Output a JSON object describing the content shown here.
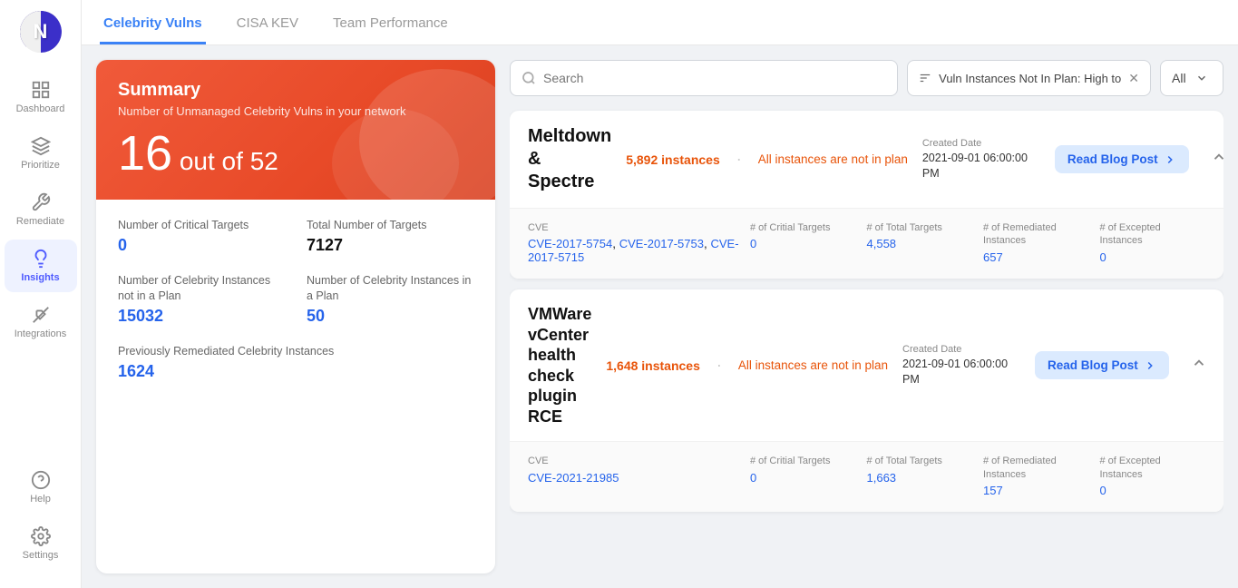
{
  "app": {
    "logo_letter": "N"
  },
  "sidebar": {
    "items": [
      {
        "id": "dashboard",
        "label": "Dashboard",
        "icon": "grid"
      },
      {
        "id": "prioritize",
        "label": "Prioritize",
        "icon": "layers"
      },
      {
        "id": "remediate",
        "label": "Remediate",
        "icon": "wrench"
      },
      {
        "id": "insights",
        "label": "Insights",
        "icon": "lightbulb",
        "active": true
      },
      {
        "id": "integrations",
        "label": "Integrations",
        "icon": "plug"
      }
    ],
    "bottom_items": [
      {
        "id": "help",
        "label": "Help",
        "icon": "question"
      },
      {
        "id": "settings",
        "label": "Settings",
        "icon": "gear"
      }
    ]
  },
  "tabs": [
    {
      "id": "celebrity-vulns",
      "label": "Celebrity Vulns",
      "active": true
    },
    {
      "id": "cisa-kev",
      "label": "CISA KEV",
      "active": false
    },
    {
      "id": "team-performance",
      "label": "Team Performance",
      "active": false
    }
  ],
  "summary": {
    "title": "Summary",
    "subtitle": "Number of Unmanaged Celebrity Vulns in your network",
    "count": "16",
    "out_of": "out of 52",
    "stats": [
      {
        "id": "critical-targets",
        "label": "Number of Critical Targets",
        "value": "0",
        "link": true
      },
      {
        "id": "total-targets",
        "label": "Total Number of Targets",
        "value": "7127",
        "link": false
      },
      {
        "id": "instances-not-in-plan",
        "label": "Number of Celebrity Instances not in a Plan",
        "value": "15032",
        "link": true
      },
      {
        "id": "instances-in-plan",
        "label": "Number of Celebrity Instances in a Plan",
        "value": "50",
        "link": true
      },
      {
        "id": "previously-remediated",
        "label": "Previously Remediated Celebrity Instances",
        "value": "1624",
        "link": true
      }
    ]
  },
  "filters": {
    "search_placeholder": "Search",
    "filter_label": "Vuln Instances Not In Plan: High to",
    "dropdown_label": "All"
  },
  "vulns": [
    {
      "id": "meltdown-spectre",
      "name": "Meltdown & Spectre",
      "instances_count": "5,892",
      "instances_label": "instances",
      "all_instances_label": "All instances are not in plan",
      "created_date_label": "Created Date",
      "created_date": "2021-09-01 06:00:00 PM",
      "blog_btn_label": "Read Blog Post",
      "cves": [
        {
          "id": "CVE-2017-5754",
          "label": "CVE-2017-5754"
        },
        {
          "id": "CVE-2017-5753",
          "label": "CVE-2017-5753"
        },
        {
          "id": "CVE-2017-5715",
          "label": "CVE-2017-5715"
        }
      ],
      "critical_targets_label": "# of Critial Targets",
      "critical_targets_value": "0",
      "total_targets_label": "# of Total Targets",
      "total_targets_value": "4,558",
      "remediated_label": "# of Remediated Instances",
      "remediated_value": "657",
      "excepted_label": "# of Excepted Instances",
      "excepted_value": "0"
    },
    {
      "id": "vmware-vcenter",
      "name": "VMWare vCenter health check plugin RCE",
      "instances_count": "1,648",
      "instances_label": "instances",
      "all_instances_label": "All instances are not in plan",
      "created_date_label": "Created Date",
      "created_date": "2021-09-01 06:00:00 PM",
      "blog_btn_label": "Read Blog Post",
      "cves": [
        {
          "id": "CVE-2021-21985",
          "label": "CVE-2021-21985"
        }
      ],
      "critical_targets_label": "# of Critial Targets",
      "critical_targets_value": "0",
      "total_targets_label": "# of Total Targets",
      "total_targets_value": "1,663",
      "remediated_label": "# of Remediated Instances",
      "remediated_value": "157",
      "excepted_label": "# of Excepted Instances",
      "excepted_value": "0"
    }
  ]
}
